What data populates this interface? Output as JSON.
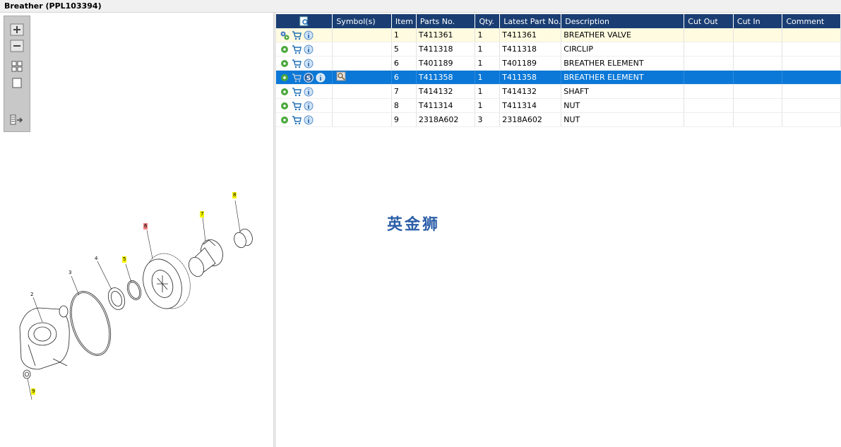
{
  "window": {
    "title": "Breather (PPL103394)"
  },
  "table": {
    "headers": [
      "",
      "Symbol(s)",
      "Item",
      "Parts No.",
      "Qty.",
      "Latest Part No.",
      "Description",
      "Cut Out",
      "Cut In",
      "Comment"
    ],
    "rows": [
      {
        "item": "1",
        "part_no": "T411361",
        "qty": "1",
        "latest": "T411361",
        "description": "BREATHER VALVE",
        "cut_out": "",
        "cut_in": "",
        "comment": ""
      },
      {
        "item": "5",
        "part_no": "T411318",
        "qty": "1",
        "latest": "T411318",
        "description": "CIRCLIP",
        "cut_out": "",
        "cut_in": "",
        "comment": ""
      },
      {
        "item": "6",
        "part_no": "T401189",
        "qty": "1",
        "latest": "T401189",
        "description": "BREATHER ELEMENT",
        "cut_out": "",
        "cut_in": "",
        "comment": ""
      },
      {
        "item": "6",
        "part_no": "T411358",
        "qty": "1",
        "latest": "T411358",
        "description": "BREATHER ELEMENT",
        "cut_out": "",
        "cut_in": "",
        "comment": ""
      },
      {
        "item": "7",
        "part_no": "T414132",
        "qty": "1",
        "latest": "T414132",
        "description": "SHAFT",
        "cut_out": "",
        "cut_in": "",
        "comment": ""
      },
      {
        "item": "8",
        "part_no": "T411314",
        "qty": "1",
        "latest": "T411314",
        "description": "NUT",
        "cut_out": "",
        "cut_in": "",
        "comment": ""
      },
      {
        "item": "9",
        "part_no": "2318A602",
        "qty": "3",
        "latest": "2318A602",
        "description": "NUT",
        "cut_out": "",
        "cut_in": "",
        "comment": ""
      }
    ]
  },
  "drawing": {
    "callouts": [
      "2",
      "3",
      "4",
      "5",
      "6",
      "7",
      "8",
      "9"
    ]
  },
  "watermark": "英金狮",
  "icons": {
    "zoom_in": "zoom-in-icon",
    "zoom_out": "zoom-out-icon",
    "fit": "fit-all-icon",
    "actual": "actual-size-icon",
    "toggle": "toggle-list-icon",
    "gear": "gear-icon",
    "cart": "cart-icon",
    "info": "info-icon",
    "symbol_s": "symbol-s-icon",
    "search": "search-icon"
  },
  "colors": {
    "header_bg": "#1a3e73",
    "selected_row": "#0b78d7",
    "first_row": "#fffbe0",
    "highlight_callout": "#f5f500",
    "red_callout": "#f08080"
  }
}
